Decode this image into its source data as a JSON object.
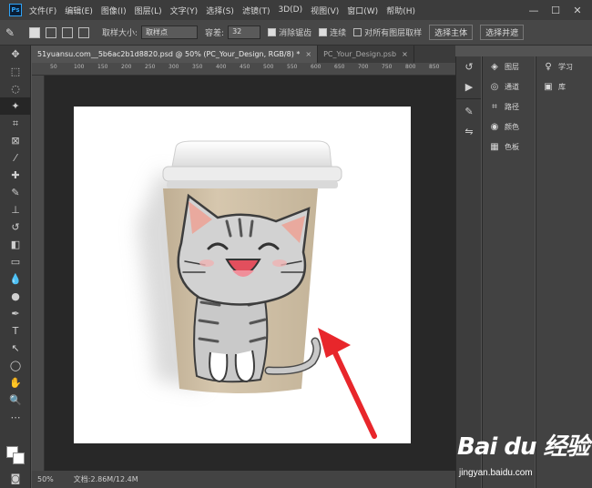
{
  "menubar": {
    "logo": "Ps",
    "items": [
      "文件(F)",
      "编辑(E)",
      "图像(I)",
      "图层(L)",
      "文字(Y)",
      "选择(S)",
      "滤镜(T)",
      "3D(D)",
      "视图(V)",
      "窗口(W)",
      "帮助(H)"
    ],
    "controls": [
      "—",
      "☐",
      "✕"
    ]
  },
  "options": {
    "tool_glyph": "✎",
    "sample_size_label": "取样大小:",
    "sample_size_value": "取样点",
    "tolerance_label": "容差:",
    "tolerance_value": "32",
    "antialias_label": "消除锯齿",
    "contiguous_label": "连续",
    "sample_all_label": "对所有图层取样",
    "select_subject": "选择主体",
    "select_and_mask": "选择并遮"
  },
  "tabs": [
    {
      "label": "51yuansu.com__5b6ac2b1d8820.psd @ 50% (PC_Your_Design, RGB/8) *",
      "close": "×"
    },
    {
      "label": "PC_Your_Design.psb",
      "close": "×"
    }
  ],
  "ruler": {
    "top": [
      "50",
      "100",
      "150",
      "200",
      "250",
      "300",
      "350",
      "400",
      "450",
      "500",
      "550",
      "600",
      "650",
      "700",
      "750",
      "800",
      "850"
    ]
  },
  "statusbar": {
    "zoom": "50%",
    "doc_info": "文档:2.86M/12.4M"
  },
  "panels": {
    "col1": [
      {
        "icon": "layers-icon",
        "glyph": "◈",
        "label": "图层"
      },
      {
        "icon": "channels-icon",
        "glyph": "◎",
        "label": "通道"
      },
      {
        "icon": "paths-icon",
        "glyph": "⌗",
        "label": "路径"
      },
      {
        "icon": "color-icon",
        "glyph": "◉",
        "label": "颜色"
      },
      {
        "icon": "swatches-icon",
        "glyph": "▦",
        "label": "色板"
      }
    ],
    "col2": [
      {
        "icon": "learn-icon",
        "glyph": "♀",
        "label": "学习"
      },
      {
        "icon": "library-icon",
        "glyph": "▣",
        "label": "库"
      }
    ]
  },
  "watermark": {
    "brand": "Bai du 经验",
    "sub": "jingyan.baidu.com"
  },
  "colors": {
    "arrow": "#e8262b",
    "cup_body": "#d1c1a7",
    "lid": "#f2f2f2",
    "cat_fur": "#c9c9c9",
    "cat_stripe": "#555555"
  }
}
